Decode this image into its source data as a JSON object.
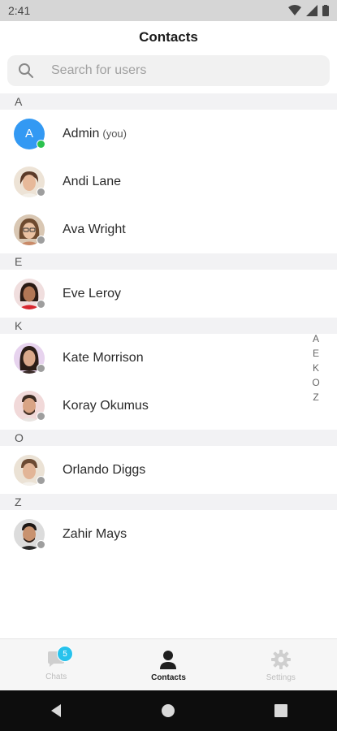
{
  "status_bar": {
    "time": "2:41"
  },
  "header": {
    "title": "Contacts"
  },
  "search": {
    "placeholder": "Search for users",
    "value": ""
  },
  "sections": [
    {
      "letter": "A",
      "contacts": [
        {
          "name": "Admin",
          "suffix": "(you)",
          "initial": "A",
          "status": "online"
        },
        {
          "name": "Andi Lane",
          "status": "offline"
        },
        {
          "name": "Ava Wright",
          "status": "offline"
        }
      ]
    },
    {
      "letter": "E",
      "contacts": [
        {
          "name": "Eve Leroy",
          "status": "offline"
        }
      ]
    },
    {
      "letter": "K",
      "contacts": [
        {
          "name": "Kate Morrison",
          "status": "offline"
        },
        {
          "name": "Koray Okumus",
          "status": "offline"
        }
      ]
    },
    {
      "letter": "O",
      "contacts": [
        {
          "name": "Orlando Diggs",
          "status": "offline"
        }
      ]
    },
    {
      "letter": "Z",
      "contacts": [
        {
          "name": "Zahir Mays",
          "status": "offline"
        }
      ]
    }
  ],
  "alpha_index": [
    "A",
    "E",
    "K",
    "O",
    "Z"
  ],
  "tabs": [
    {
      "label": "Chats",
      "icon": "chat-bubble-icon",
      "badge": "5",
      "active": false
    },
    {
      "label": "Contacts",
      "icon": "person-icon",
      "active": true
    },
    {
      "label": "Settings",
      "icon": "gear-icon",
      "active": false
    }
  ],
  "colors": {
    "accent": "#3399f3",
    "online": "#2bc24e",
    "offline": "#9e9e9e",
    "badge": "#27c2ec"
  }
}
